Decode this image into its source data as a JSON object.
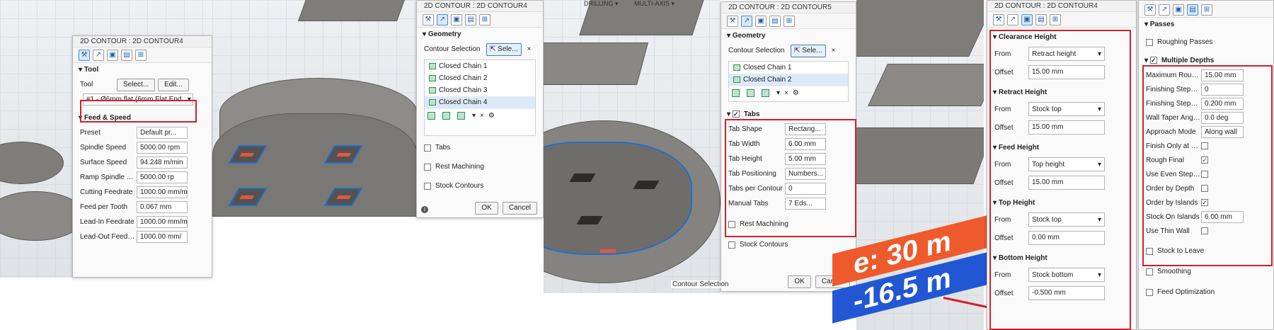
{
  "panel1": {
    "title": "2D CONTOUR : 2D CONTOUR4",
    "tool_section": "Tool",
    "tool_label": "Tool",
    "select_btn": "Select...",
    "edit_btn": "Edit...",
    "tool_value": "#1 - Ø6mm flat (6mm Flat End...",
    "feed_section": "Feed & Speed",
    "rows": [
      {
        "label": "Preset",
        "value": "Default pr..."
      },
      {
        "label": "Spindle Speed",
        "value": "5000.00 rpm"
      },
      {
        "label": "Surface Speed",
        "value": "94.248 m/min"
      },
      {
        "label": "Ramp Spindle Spe...",
        "value": "5000.00 rp"
      },
      {
        "label": "Cutting Feedrate",
        "value": "1000.00 mm/m"
      },
      {
        "label": "Feed per Tooth",
        "value": "0.067 mm"
      },
      {
        "label": "Lead-In Feedrate",
        "value": "1000.00 mm/m"
      },
      {
        "label": "Lead-Out Feedrate",
        "value": "1000.00 mm/"
      }
    ]
  },
  "panel2": {
    "title": "2D CONTOUR : 2D CONTOUR4",
    "geometry": "Geometry",
    "contour_label": "Contour Selection",
    "sele": "Sele...",
    "chains": [
      "Closed Chain 1",
      "Closed Chain 2",
      "Closed Chain 3",
      "Closed Chain 4"
    ],
    "tabs": "Tabs",
    "rest": "Rest Machining",
    "stock": "Stock Contours",
    "ok": "OK",
    "cancel": "Cancel"
  },
  "topbar": {
    "drilling": "DRILLING ▾",
    "multiaxis": "MULTI-AXIS ▾"
  },
  "panel3": {
    "title": "2D CONTOUR : 2D CONTOUR5",
    "geometry": "Geometry",
    "contour_label": "Contour Selection",
    "sele": "Sele...",
    "chains": [
      "Closed Chain 1",
      "Closed Chain 2"
    ],
    "tabs": "Tabs",
    "tab_rows": [
      {
        "label": "Tab Shape",
        "value": "Rectang..."
      },
      {
        "label": "Tab Width",
        "value": "6.00 mm"
      },
      {
        "label": "Tab Height",
        "value": "5.00 mm"
      },
      {
        "label": "Tab Positioning",
        "value": "Numbers..."
      },
      {
        "label": "Tabs per Contour",
        "value": "0"
      },
      {
        "label": "Manual Tabs",
        "value": "7 Eds..."
      }
    ],
    "rest": "Rest Machining",
    "stock": "Stock Contours",
    "tooltip": "Contour Selection",
    "ok": "OK",
    "cancel": "Cancel"
  },
  "overlay": {
    "text1": "e: 30 m",
    "text2": "-16.5 m"
  },
  "panel4": {
    "title": "2D CONTOUR : 2D CONTOUR4",
    "sections": [
      {
        "name": "Clearance Height",
        "from": "Retract height",
        "offset": "15.00 mm"
      },
      {
        "name": "Retract Height",
        "from": "Stock top",
        "offset": "15.00 mm"
      },
      {
        "name": "Feed Height",
        "from": "Top height",
        "offset": "15.00 mm"
      },
      {
        "name": "Top Height",
        "from": "Stock top",
        "offset": "0.00 mm"
      },
      {
        "name": "Bottom Height",
        "from": "Stock bottom",
        "offset": "-0.500 mm"
      }
    ],
    "from_label": "From",
    "offset_label": "Offset"
  },
  "panel5": {
    "passes": "Passes",
    "roughing": "Roughing Passes",
    "multiple_depths": "Multiple Depths",
    "rows": [
      {
        "label": "Maximum Roughi...",
        "value": "15.00 mm",
        "kind": "input"
      },
      {
        "label": "Finishing Stepdo...",
        "value": "0",
        "kind": "spin"
      },
      {
        "label": "Finishing Stepdo...",
        "value": "0.200 mm",
        "kind": "input"
      },
      {
        "label": "Wall Taper Angle ...",
        "value": "0.0 deg",
        "kind": "input"
      },
      {
        "label": "Approach Mode",
        "value": "Along wall",
        "kind": "select"
      },
      {
        "label": "Finish Only at Fin...",
        "value": "",
        "kind": "check"
      },
      {
        "label": "Rough Final",
        "value": "✓",
        "kind": "check"
      },
      {
        "label": "Use Even Stepdo...",
        "value": "",
        "kind": "check"
      },
      {
        "label": "Order by Depth",
        "value": "",
        "kind": "check"
      },
      {
        "label": "Order by Islands",
        "value": "✓",
        "kind": "check"
      },
      {
        "label": "Stock On Islands",
        "value": "6.00 mm",
        "kind": "input"
      },
      {
        "label": "Use Thin Wall",
        "value": "",
        "kind": "check"
      }
    ],
    "stock_to_leave": "Stock to Leave",
    "smoothing": "Smoothing",
    "feed_opt": "Feed Optimization"
  },
  "colors": {
    "highlight": "#d4202a",
    "selection": "#1f6fd0",
    "part": "#7f7d7a"
  }
}
